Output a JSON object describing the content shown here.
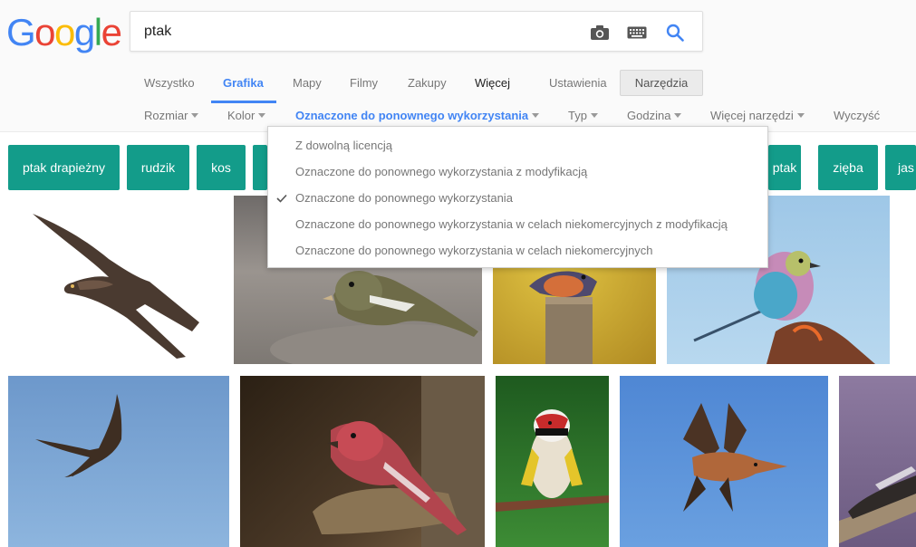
{
  "logo": {
    "letters": [
      {
        "char": "G",
        "color": "#4285f4"
      },
      {
        "char": "o",
        "color": "#ea4335"
      },
      {
        "char": "o",
        "color": "#fbbc05"
      },
      {
        "char": "g",
        "color": "#4285f4"
      },
      {
        "char": "l",
        "color": "#34a853"
      },
      {
        "char": "e",
        "color": "#ea4335"
      }
    ]
  },
  "search": {
    "value": "ptak",
    "icons": [
      "camera-icon",
      "keyboard-icon",
      "search-icon"
    ],
    "accent": "#4285f4"
  },
  "tabs": {
    "items": [
      {
        "label": "Wszystko",
        "active": false
      },
      {
        "label": "Grafika",
        "active": true
      },
      {
        "label": "Mapy",
        "active": false
      },
      {
        "label": "Filmy",
        "active": false
      },
      {
        "label": "Zakupy",
        "active": false
      },
      {
        "label": "Więcej",
        "active": false
      },
      {
        "label": "Ustawienia",
        "active": false
      }
    ],
    "tools_button": "Narzędzia"
  },
  "tools": {
    "items": [
      {
        "label": "Rozmiar",
        "active": false
      },
      {
        "label": "Kolor",
        "active": false
      },
      {
        "label": "Oznaczone do ponownego wykorzystania",
        "active": true
      },
      {
        "label": "Typ",
        "active": false
      },
      {
        "label": "Godzina",
        "active": false
      },
      {
        "label": "Więcej narzędzi",
        "active": false
      }
    ],
    "clear": "Wyczyść"
  },
  "chips": [
    "ptak drapieżny",
    "rudzik",
    "kos",
    "ptak",
    "zięba",
    "jaskółka"
  ],
  "chip_color": "#139c8a",
  "dropdown": {
    "items": [
      {
        "label": "Z dowolną licencją",
        "checked": false
      },
      {
        "label": "Oznaczone do ponownego wykorzystania z modyfikacją",
        "checked": false
      },
      {
        "label": "Oznaczone do ponownego wykorzystania",
        "checked": true
      },
      {
        "label": "Oznaczone do ponownego wykorzystania w celach niekomercyjnych z modyfikacją",
        "checked": false
      },
      {
        "label": "Oznaczone do ponownego wykorzystania w celach niekomercyjnych",
        "checked": false
      }
    ]
  },
  "images": [
    {
      "subject": "black kite in flight on white",
      "bg": "#ffffff"
    },
    {
      "subject": "finch on grey rock",
      "bg": "#8a8580"
    },
    {
      "subject": "bird on wooden post yellow background",
      "bg": "#c9a531"
    },
    {
      "subject": "lilac-breasted roller on branch",
      "bg": "#a9cde6"
    },
    {
      "subject": "kite in flight blue sky",
      "bg": "#7ea7d4"
    },
    {
      "subject": "pine grosbeak on log",
      "bg": "#4a3a28"
    },
    {
      "subject": "goldfinch on branch",
      "bg": "#2f6e2b"
    },
    {
      "subject": "red kite in flight blue sky",
      "bg": "#5a8fd6"
    },
    {
      "subject": "bird on wooden plank",
      "bg": "#8d7aa0"
    }
  ]
}
